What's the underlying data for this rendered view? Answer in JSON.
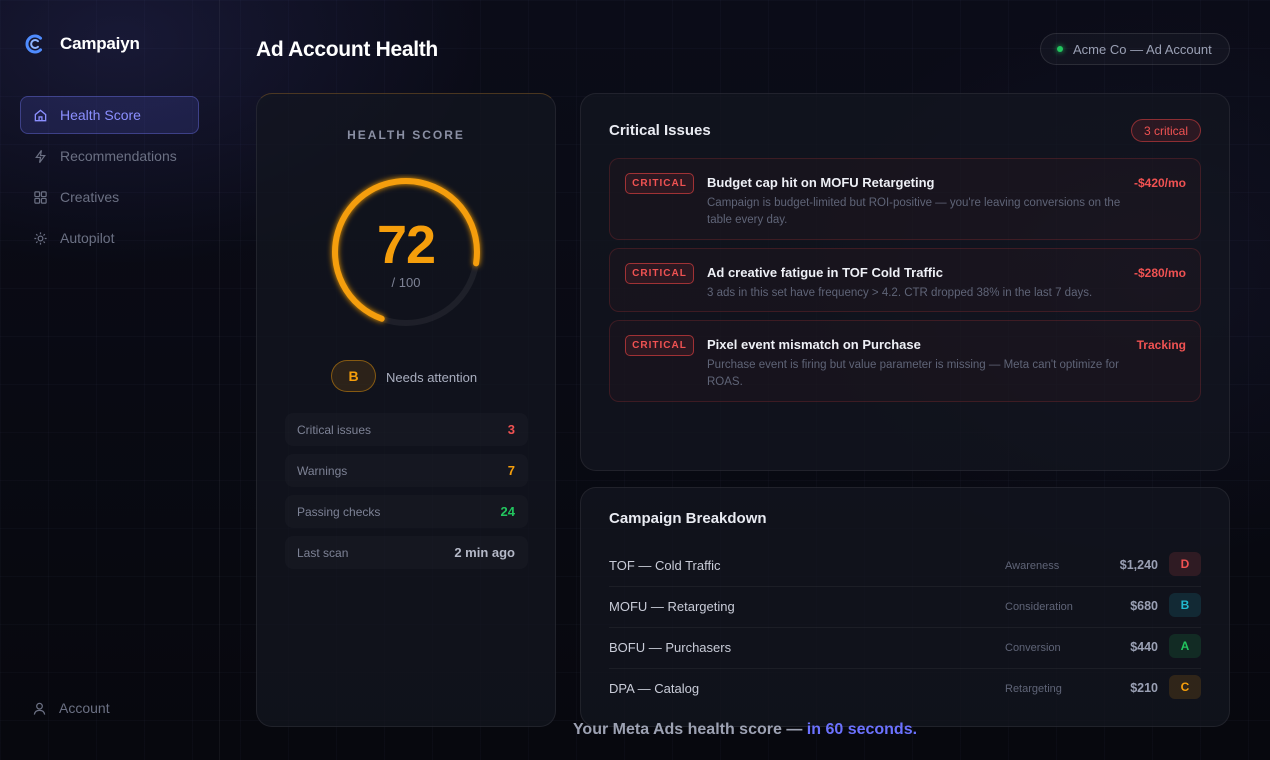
{
  "brand": {
    "name": "Campaiyn"
  },
  "nav": {
    "items": [
      {
        "label": "Health Score",
        "active": true
      },
      {
        "label": "Recommendations",
        "active": false
      },
      {
        "label": "Creatives",
        "active": false
      },
      {
        "label": "Autopilot",
        "active": false
      }
    ],
    "account": "Account"
  },
  "header": {
    "title": "Ad Account Health",
    "account_name": "Acme Co — Ad Account"
  },
  "health": {
    "heading": "HEALTH SCORE",
    "score": "72",
    "max": "/ 100",
    "score_fraction": 0.72,
    "grade": "B",
    "grade_label": "Needs attention",
    "stats": [
      {
        "label": "Critical issues",
        "value": "3",
        "color": "#f05252"
      },
      {
        "label": "Warnings",
        "value": "7",
        "color": "#f59e0b"
      },
      {
        "label": "Passing checks",
        "value": "24",
        "color": "#22c55e"
      },
      {
        "label": "Last scan",
        "value": "2 min ago",
        "color": "#b4b8c7"
      }
    ]
  },
  "issues": {
    "title": "Critical Issues",
    "badge": "3 critical",
    "items": [
      {
        "tag": "CRITICAL",
        "title": "Budget cap hit on MOFU Retargeting",
        "desc": "Campaign is budget-limited but ROI-positive — you're leaving conversions on the table every day.",
        "impact": "-$420/mo"
      },
      {
        "tag": "CRITICAL",
        "title": "Ad creative fatigue in TOF Cold Traffic",
        "desc": "3 ads in this set have frequency > 4.2. CTR dropped 38% in the last 7 days.",
        "impact": "-$280/mo"
      },
      {
        "tag": "CRITICAL",
        "title": "Pixel event mismatch on Purchase",
        "desc": "Purchase event is firing but value parameter is missing — Meta can't optimize for ROAS.",
        "impact": "Tracking"
      }
    ]
  },
  "breakdown": {
    "title": "Campaign Breakdown",
    "rows": [
      {
        "name": "TOF — Cold Traffic",
        "objective": "Awareness",
        "spend": "$1,240",
        "grade": "D",
        "color": "#f05252"
      },
      {
        "name": "MOFU — Retargeting",
        "objective": "Consideration",
        "spend": "$680",
        "grade": "B",
        "color": "#22b8cf"
      },
      {
        "name": "BOFU — Purchasers",
        "objective": "Conversion",
        "spend": "$440",
        "grade": "A",
        "color": "#22c55e"
      },
      {
        "name": "DPA — Catalog",
        "objective": "Retargeting",
        "spend": "$210",
        "grade": "C",
        "color": "#f59e0b"
      }
    ]
  },
  "footer": {
    "text": "Your Meta Ads health score —",
    "accent": "in 60 seconds."
  }
}
